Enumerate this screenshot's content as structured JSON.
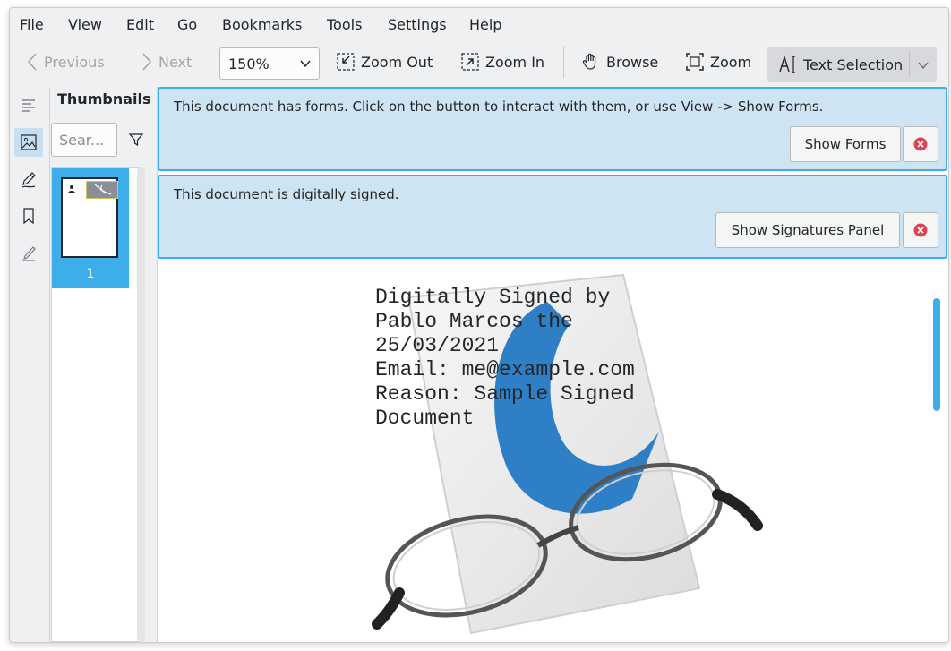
{
  "menubar": [
    "File",
    "View",
    "Edit",
    "Go",
    "Bookmarks",
    "Tools",
    "Settings",
    "Help"
  ],
  "toolbar": {
    "previous": "Previous",
    "next": "Next",
    "zoom_value": "150%",
    "zoom_out": "Zoom Out",
    "zoom_in": "Zoom In",
    "browse": "Browse",
    "zoom": "Zoom",
    "text_selection": "Text Selection"
  },
  "sidebar": {
    "title": "Thumbnails",
    "search_placeholder": "Sear...",
    "page_number": "1"
  },
  "banners": {
    "forms_message": "This document has forms. Click on the button to interact with them, or use View -> Show Forms.",
    "forms_button": "Show Forms",
    "signed_message": "This document is digitally signed.",
    "signatures_button": "Show Signatures Panel"
  },
  "document": {
    "lines": [
      "Digitally Signed by",
      "Pablo Marcos the",
      "25/03/2021",
      "Email: me@example.com",
      "Reason: Sample Signed",
      "Document"
    ]
  },
  "colors": {
    "accent": "#3daee9",
    "banner_bg": "#cfe4f2",
    "close_red": "#da4453",
    "window_bg": "#eff0f1"
  }
}
